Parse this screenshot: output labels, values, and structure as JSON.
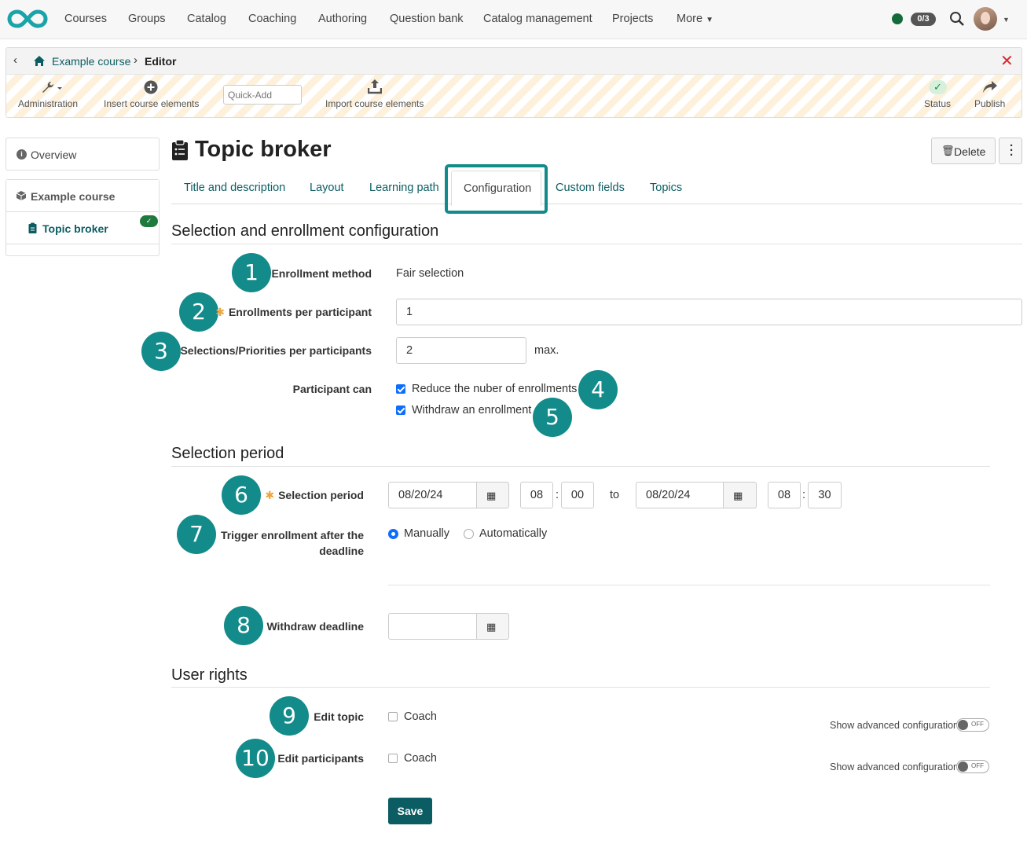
{
  "nav": {
    "items": [
      "Courses",
      "Groups",
      "Catalog",
      "Coaching",
      "Authoring",
      "Question bank",
      "Catalog management",
      "Projects",
      "More"
    ],
    "badge": "0/3"
  },
  "breadcrumb": {
    "course": "Example course",
    "current": "Editor"
  },
  "toolbar": {
    "administration": "Administration",
    "insert": "Insert course elements",
    "quickadd_placeholder": "Quick-Add",
    "import": "Import course elements",
    "status": "Status",
    "publish": "Publish"
  },
  "sidebar": {
    "overview": "Overview",
    "course": "Example course",
    "node": "Topic broker"
  },
  "page": {
    "title": "Topic broker",
    "delete": "Delete"
  },
  "tabs": [
    "Title and description",
    "Layout",
    "Learning path",
    "Configuration",
    "Custom fields",
    "Topics"
  ],
  "sections": {
    "enrollment": "Selection and enrollment configuration",
    "period": "Selection period",
    "rights": "User rights"
  },
  "form": {
    "enrollment_method_label": "Enrollment method",
    "enrollment_method_value": "Fair selection",
    "enrollments_label": "Enrollments per participant",
    "enrollments_value": "1",
    "selections_label": "Selections/Priorities per participants",
    "selections_value": "2",
    "selections_suffix": "max.",
    "participant_can_label": "Participant can",
    "reduce_label": "Reduce the nuber of enrollments",
    "withdraw_enroll_label": "Withdraw an enrollment",
    "period_label": "Selection period",
    "start_date": "08/20/24",
    "start_hour": "08",
    "start_min": "00",
    "to": "to",
    "end_date": "08/20/24",
    "end_hour": "08",
    "end_min": "30",
    "trigger_label_1": "Trigger enrollment after the",
    "trigger_label_2": "deadline",
    "manually": "Manually",
    "automatically": "Automatically",
    "withdraw_deadline_label": "Withdraw deadline",
    "edit_topic_label": "Edit topic",
    "edit_participants_label": "Edit participants",
    "coach": "Coach",
    "advanced": "Show advanced configuration",
    "off": "OFF",
    "save": "Save"
  },
  "markers": [
    "1",
    "2",
    "3",
    "4",
    "5",
    "6",
    "7",
    "8",
    "9",
    "10"
  ],
  "colors": {
    "accent": "#128b8a",
    "link": "#0b5d63",
    "primary": "#0d6efd",
    "save": "#0b5d63"
  }
}
